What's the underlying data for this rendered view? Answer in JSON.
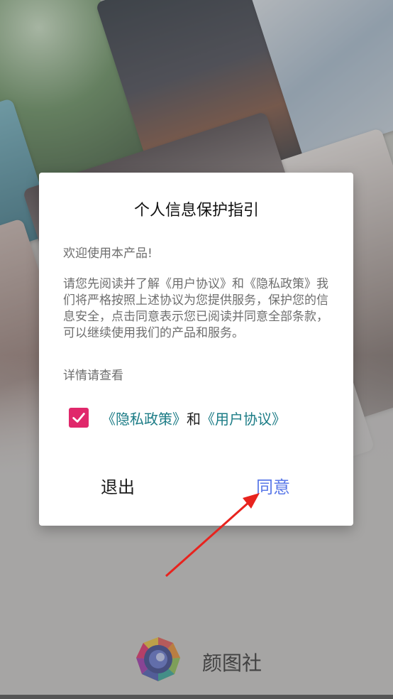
{
  "dialog": {
    "title": "个人信息保护指引",
    "welcome": "欢迎使用本产品!",
    "body": "请您先阅读并了解《用户协议》和《隐私政策》我们将严格按照上述协议为您提供服务，保护您的信息安全，点击同意表示您已阅读并同意全部条款，可以继续使用我们的产品和服务。",
    "details": "详情请查看",
    "consent": {
      "checked": true,
      "privacy_link": "《隐私政策》",
      "conjunction": "和",
      "user_link": "《用户协议》"
    },
    "exit_label": "退出",
    "agree_label": "同意"
  },
  "brand": {
    "name": "颜图社"
  },
  "colors": {
    "checkbox": "#e0286b",
    "link": "#1c7c86",
    "agree": "#5a78e8",
    "annotation_arrow": "#e8231e"
  },
  "icons": {
    "checkbox_check": "checkmark-icon",
    "logo": "app-logo-icon"
  }
}
